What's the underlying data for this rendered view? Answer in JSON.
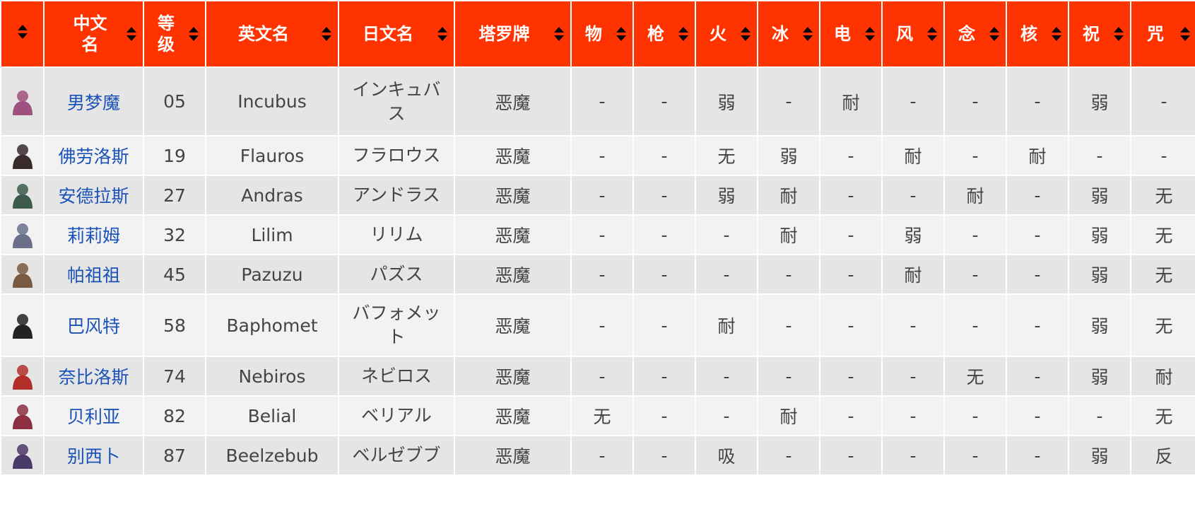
{
  "header": {
    "cn_name_l1": "中文",
    "cn_name_l2": "名",
    "level_l1": "等",
    "level_l2": "级",
    "en_name": "英文名",
    "jp_name": "日文名",
    "tarot": "塔罗牌",
    "res": [
      "物",
      "枪",
      "火",
      "冰",
      "电",
      "风",
      "念",
      "核",
      "祝",
      "咒"
    ]
  },
  "colors": {
    "header_bg": "#ff3300",
    "link": "#1a52b8",
    "row_odd": "#e5e5e5",
    "row_even": "#f2f2f2"
  },
  "rows": [
    {
      "avatar": "incubus-avatar",
      "avatar_color": "#a05080",
      "cn": "男梦魔",
      "lv": "05",
      "en": "Incubus",
      "jp1": "インキュバ",
      "jp2": "ス",
      "tarot": "恶魔",
      "res": [
        "-",
        "-",
        "弱",
        "-",
        "耐",
        "-",
        "-",
        "-",
        "弱",
        "-"
      ]
    },
    {
      "avatar": "flauros-avatar",
      "avatar_color": "#3a2a2a",
      "cn": "佛劳洛斯",
      "lv": "19",
      "en": "Flauros",
      "jp1": "フラロウス",
      "jp2": "",
      "tarot": "恶魔",
      "res": [
        "-",
        "-",
        "无",
        "弱",
        "-",
        "耐",
        "-",
        "耐",
        "-",
        "-"
      ]
    },
    {
      "avatar": "andras-avatar",
      "avatar_color": "#3d5a4a",
      "cn": "安德拉斯",
      "lv": "27",
      "en": "Andras",
      "jp1": "アンドラス",
      "jp2": "",
      "tarot": "恶魔",
      "res": [
        "-",
        "-",
        "弱",
        "耐",
        "-",
        "-",
        "耐",
        "-",
        "弱",
        "无"
      ]
    },
    {
      "avatar": "lilim-avatar",
      "avatar_color": "#6a7088",
      "cn": "莉莉姆",
      "lv": "32",
      "en": "Lilim",
      "jp1": "リリム",
      "jp2": "",
      "tarot": "恶魔",
      "res": [
        "-",
        "-",
        "-",
        "耐",
        "-",
        "弱",
        "-",
        "-",
        "弱",
        "无"
      ]
    },
    {
      "avatar": "pazuzu-avatar",
      "avatar_color": "#7a5a40",
      "cn": "帕祖祖",
      "lv": "45",
      "en": "Pazuzu",
      "jp1": "パズス",
      "jp2": "",
      "tarot": "恶魔",
      "res": [
        "-",
        "-",
        "-",
        "-",
        "-",
        "耐",
        "-",
        "-",
        "弱",
        "无"
      ]
    },
    {
      "avatar": "baphomet-avatar",
      "avatar_color": "#222222",
      "cn": "巴风特",
      "lv": "58",
      "en": "Baphomet",
      "jp1": "バフォメッ",
      "jp2": "ト",
      "tarot": "恶魔",
      "res": [
        "-",
        "-",
        "耐",
        "-",
        "-",
        "-",
        "-",
        "-",
        "弱",
        "无"
      ]
    },
    {
      "avatar": "nebiros-avatar",
      "avatar_color": "#b03028",
      "cn": "奈比洛斯",
      "lv": "74",
      "en": "Nebiros",
      "jp1": "ネビロス",
      "jp2": "",
      "tarot": "恶魔",
      "res": [
        "-",
        "-",
        "-",
        "-",
        "-",
        "-",
        "无",
        "-",
        "弱",
        "耐"
      ]
    },
    {
      "avatar": "belial-avatar",
      "avatar_color": "#8a3040",
      "cn": "贝利亚",
      "lv": "82",
      "en": "Belial",
      "jp1": "ベリアル",
      "jp2": "",
      "tarot": "恶魔",
      "res": [
        "无",
        "-",
        "-",
        "耐",
        "-",
        "-",
        "-",
        "-",
        "-",
        "无"
      ]
    },
    {
      "avatar": "beelzebub-avatar",
      "avatar_color": "#4a3a6a",
      "cn": "别西卜",
      "lv": "87",
      "en": "Beelzebub",
      "jp1": "ベルゼブブ",
      "jp2": "",
      "tarot": "恶魔",
      "res": [
        "-",
        "-",
        "吸",
        "-",
        "-",
        "-",
        "-",
        "-",
        "弱",
        "反"
      ]
    }
  ]
}
